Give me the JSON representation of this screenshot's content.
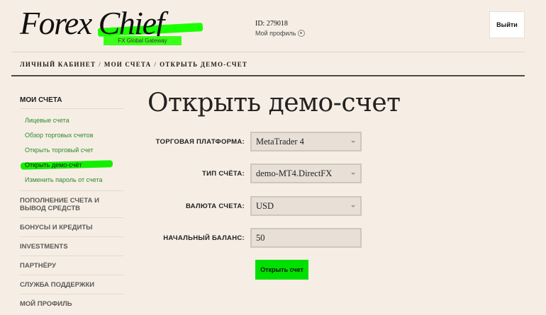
{
  "header": {
    "logo_text": "Forex Chief",
    "logo_subtitle": "FX Global Gateway",
    "user_id": "ID: 279018",
    "profile_link": "Мой профиль",
    "logout_label": "Выйти"
  },
  "breadcrumb": {
    "items": [
      "ЛИЧНЫЙ КАБИНЕТ",
      "МОИ СЧЕТА",
      "ОТКРЫТЬ ДЕМО-СЧЕТ"
    ],
    "separator": "/"
  },
  "sidebar": {
    "heading": "МОИ СЧЕТА",
    "sub_items": [
      {
        "label": "Лицевые счета"
      },
      {
        "label": "Обзор торговых счетов"
      },
      {
        "label": "Открыть торговый счет"
      },
      {
        "label": "Открыть демо-счёт",
        "active": true
      },
      {
        "label": "Изменить пароль от счета"
      }
    ],
    "sections": [
      "ПОПОЛНЕНИЕ СЧЕТА И ВЫВОД СРЕДСТВ",
      "БОНУСЫ И КРЕДИТЫ",
      "INVESTMENTS",
      "ПАРТНЁРУ",
      "СЛУЖБА ПОДДЕРЖКИ",
      "МОЙ ПРОФИЛЬ"
    ]
  },
  "main": {
    "title": "Открыть демо-счет",
    "form": {
      "platform_label": "ТОРГОВАЯ ПЛАТФОРМА:",
      "platform_value": "MetaTrader 4",
      "account_type_label": "ТИП СЧЁТА:",
      "account_type_value": "demo-MT4.DirectFX",
      "currency_label": "ВАЛЮТА СЧЕТА:",
      "currency_value": "USD",
      "balance_label": "НАЧАЛЬНЫЙ БАЛАНС:",
      "balance_value": "50",
      "submit_label": "Открыть счет"
    }
  },
  "colors": {
    "background": "#f6eee4",
    "accent_green": "#00e000",
    "link_green": "#2c8a2c"
  }
}
